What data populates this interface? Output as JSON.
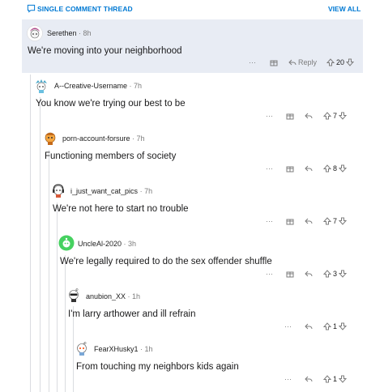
{
  "header": {
    "thread_label": "SINGLE COMMENT THREAD",
    "view_all": "VIEW ALL"
  },
  "comments": [
    {
      "author": "Serethen",
      "time": "8h",
      "text": "We're moving into your neighborhood",
      "score": "20",
      "reply_label": "Reply",
      "avatar": "snoo-pink-hair-avatar"
    },
    {
      "author": "A--Creative-Username",
      "time": "7h",
      "text": "You know we're trying our best to be",
      "score": "7",
      "avatar": "snoo-blue-hair-avatar"
    },
    {
      "author": "porn-account-forsure",
      "time": "7h",
      "text": "Functioning members of society",
      "score": "8",
      "avatar": "snoo-orange-avatar"
    },
    {
      "author": "i_just_want_cat_pics",
      "time": "7h",
      "text": "We're not here to start no trouble",
      "score": "7",
      "avatar": "snoo-headphones-avatar"
    },
    {
      "author": "UncleAl-2020",
      "time": "3h",
      "text": "We're legally required to do the sex offender shuffle",
      "score": "3",
      "avatar": "green-circle-avatar"
    },
    {
      "author": "anubion_XX",
      "time": "1h",
      "text": "I'm larry arthower and ill refrain",
      "score": "1",
      "avatar": "snoo-sunglasses-avatar"
    },
    {
      "author": "FearXHusky1",
      "time": "1h",
      "text": "From touching my neighbors kids again",
      "score": "1",
      "avatar": "snoo-avatar"
    }
  ],
  "colors": {
    "accent": "#0079d3",
    "highlight": "#e8ecf4",
    "upvote_green": "#46d160"
  }
}
